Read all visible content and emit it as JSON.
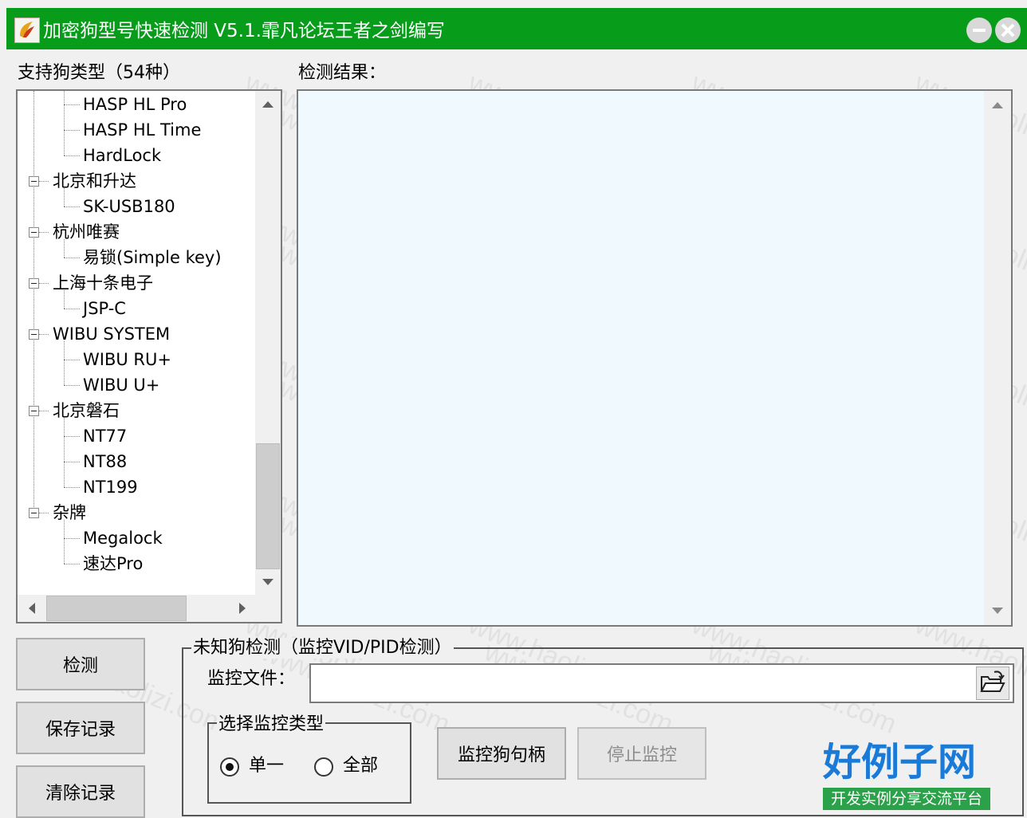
{
  "window": {
    "title": "加密狗型号快速检测 V5.1.霏凡论坛王者之剑编写"
  },
  "labels": {
    "supported_types": "支持狗类型（54种）",
    "results": "检测结果："
  },
  "tree": {
    "items": [
      {
        "label": "HASP HL Pro",
        "level": 1
      },
      {
        "label": "HASP HL Time",
        "level": 1
      },
      {
        "label": "HardLock",
        "level": 1
      },
      {
        "label": "北京和升达",
        "level": 0
      },
      {
        "label": "SK-USB180",
        "level": 1
      },
      {
        "label": "杭州唯赛",
        "level": 0
      },
      {
        "label": "易锁(Simple key)",
        "level": 1
      },
      {
        "label": "上海十条电子",
        "level": 0
      },
      {
        "label": "JSP-C",
        "level": 1
      },
      {
        "label": "WIBU SYSTEM",
        "level": 0
      },
      {
        "label": "WIBU RU+",
        "level": 1
      },
      {
        "label": "WIBU U+",
        "level": 1
      },
      {
        "label": "北京磐石",
        "level": 0
      },
      {
        "label": "NT77",
        "level": 1
      },
      {
        "label": "NT88",
        "level": 1
      },
      {
        "label": "NT199",
        "level": 1
      },
      {
        "label": "杂牌",
        "level": 0
      },
      {
        "label": "Megalock",
        "level": 1
      },
      {
        "label": "速达Pro",
        "level": 1
      }
    ],
    "scroll_position": 0.85
  },
  "buttons": {
    "detect": "检测",
    "save_log": "保存记录",
    "clear_log": "清除记录",
    "monitor_handle": "监控狗句柄",
    "stop_monitor": "停止监控"
  },
  "unknown_group": {
    "legend": "未知狗检测（监控VID/PID检测）",
    "monitor_file_label": "监控文件：",
    "monitor_file_value": ""
  },
  "monitor_type_group": {
    "legend": "选择监控类型",
    "options": [
      {
        "label": "单一",
        "checked": true
      },
      {
        "label": "全部",
        "checked": false
      }
    ]
  },
  "watermark": "www.haolizi.com",
  "brand": {
    "name": "好例子网",
    "tagline": "开发实例分享交流平台"
  },
  "colors": {
    "titlebar": "#079c1a",
    "result_bg": "#f0f9fe",
    "brand_blue": "#1a7ad8",
    "brand_green": "#2ba24a"
  }
}
